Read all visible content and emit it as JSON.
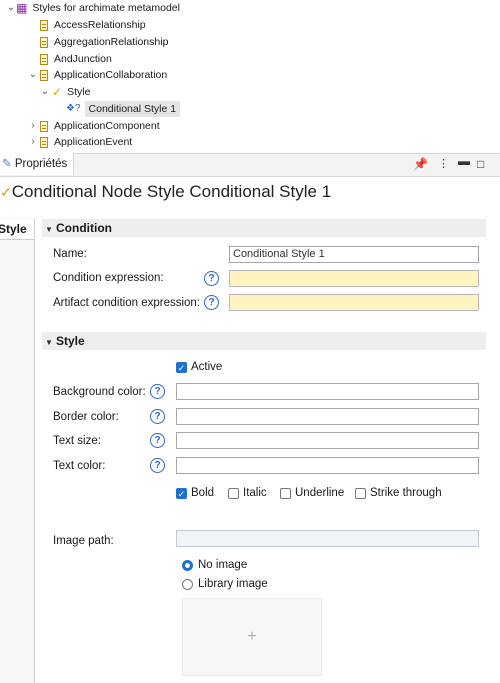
{
  "tree": {
    "root": "Styles for archimate metamodel",
    "items": [
      "AccessRelationship",
      "AggregationRelationship",
      "AndJunction",
      "ApplicationCollaboration",
      "Style",
      "Conditional Style 1",
      "ApplicationComponent",
      "ApplicationEvent"
    ]
  },
  "panel": {
    "tab_label": "Propriétés",
    "title": "Conditional Node Style Conditional Style 1",
    "vertical_tab": "Style"
  },
  "condition": {
    "header": "Condition",
    "name_label": "Name:",
    "name_value": "Conditional Style 1",
    "expr_label": "Condition expression:",
    "expr_value": "",
    "artifact_label": "Artifact condition expression:",
    "artifact_value": ""
  },
  "style": {
    "header": "Style",
    "active_label": "Active",
    "bg_label": "Background color:",
    "border_label": "Border color:",
    "text_size_label": "Text size:",
    "text_color_label": "Text color:",
    "bold_label": "Bold",
    "italic_label": "Italic",
    "underline_label": "Underline",
    "strike_label": "Strike through",
    "image_path_label": "Image path:",
    "no_image_label": "No image",
    "library_image_label": "Library image",
    "add_symbol": "+",
    "help_symbol": "?"
  },
  "colors": {
    "accent": "#1f6fd1",
    "required_bg": "#fff4c0",
    "help": "#2b66c9"
  },
  "icons": [
    "package-icon",
    "class-icon",
    "style-icon",
    "conditional-style-icon",
    "pin-icon",
    "menu-icon",
    "minimize-icon",
    "maximize-icon",
    "properties-icon"
  ]
}
